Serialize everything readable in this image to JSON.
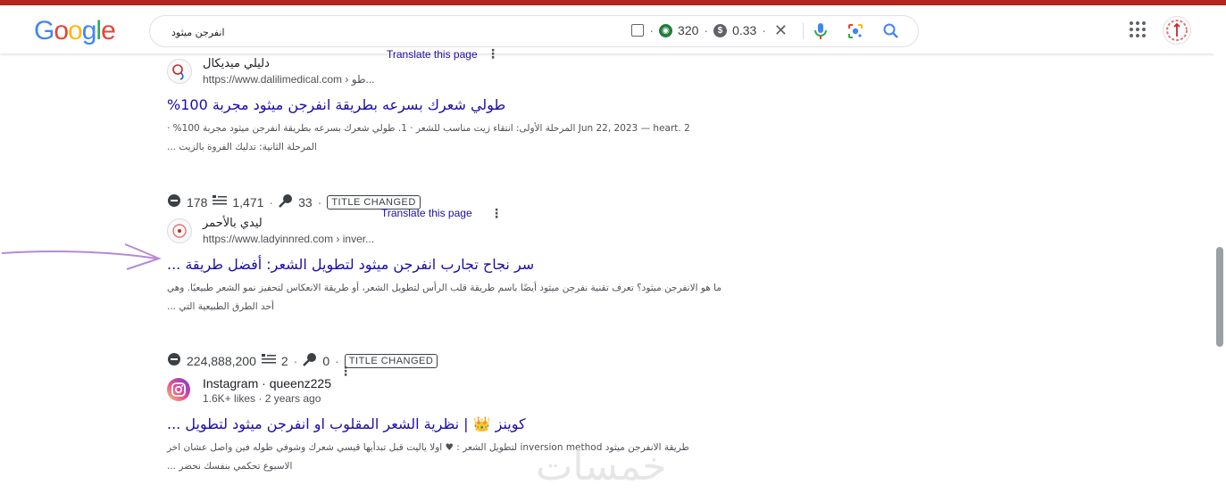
{
  "brand": {
    "logo": "Google",
    "logo_colors": [
      "#4285F4",
      "#EA4335",
      "#FBBC05",
      "#4285F4",
      "#34A853",
      "#EA4335"
    ]
  },
  "search": {
    "query": "انفرجن ميثود",
    "ext_count": "320",
    "ext_value": "0.33"
  },
  "results": [
    {
      "site_name": "دليلي ميديكال",
      "url": "https://www.dalilimedical.com",
      "url_suffix": "› طو...",
      "translate": "Translate this page",
      "title": "طولي شعرك بسرعه بطريقة انفرجن ميثود مجربة 100%",
      "snippet_line1": "Jun 22, 2023 — heart. 2 المرحلة الأولى: انتقاء زيت مناسب للشعر · 1. طولي شعرك بسرعه بطريقة انفرجن ميثود مجربة 100% ·",
      "snippet_line2": "المرحلة الثانية: تدليك الفروة بالزيت ..."
    },
    {
      "stats": {
        "s1": "178",
        "s2": "1,471",
        "s3": "33",
        "badge": "TITLE CHANGED"
      },
      "site_name": "ليدي بالأحمر",
      "url": "https://www.ladyinnred.com",
      "url_suffix": "› inver...",
      "translate": "Translate this page",
      "title": "سر نجاح تجارب انفرجن ميثود لتطويل الشعر: أفضل طريقة ...",
      "snippet_line1": "ما هو الانفرجن ميثود؟ تعرف تقنية نفرجن ميثود أيضًا باسم طريقة قلب الرأس لتطويل الشعر، أو طريقة الانعكاس لتحفيز نمو الشعر طبيعيًا. وهي",
      "snippet_line2": "أحد الطرق الطبيعية التي ..."
    },
    {
      "stats": {
        "s1": "224,888,200",
        "s2": "2",
        "s3": "0",
        "badge": "TITLE CHANGED"
      },
      "site_name": "Instagram · queenz225",
      "url": "1.6K+ likes · 2 years ago",
      "title": "كوينز 👑 | نظرية الشعر المقلوب او انفرجن ميثود لتطويل ...",
      "snippet_line1": "طريقة الانفرجن ميثود inversion method لتطويل الشعر : ♥ اولا ياليت قبل تبدأيها قيسي شعرك وشوفي طوله فين واصل عشان اخر",
      "snippet_line2": "الاسبوع تحكمي بنفسك نحضر ..."
    }
  ],
  "watermark": "خمسات",
  "colors": {
    "top_bar": "#b3261e",
    "link": "#1a0dab",
    "arrow": "#b48ad6"
  }
}
